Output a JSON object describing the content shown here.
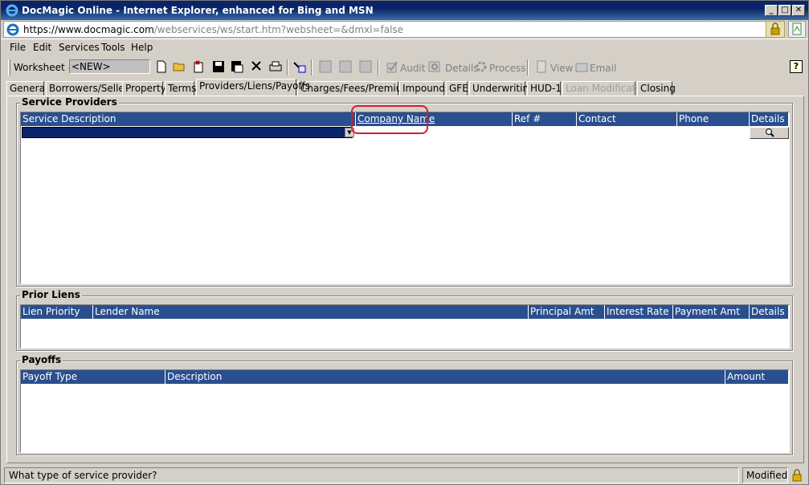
{
  "window": {
    "title": "DocMagic Online - Internet Explorer, enhanced for Bing and MSN",
    "minimize": "_",
    "maximize": "□",
    "close": "✕"
  },
  "address": {
    "url_host": "https://www.docmagic.com",
    "url_path": "/webservices/ws/start.htm?websheet=&dmxl=false"
  },
  "menu": [
    "File",
    "Edit",
    "Services",
    "Tools",
    "Help"
  ],
  "toolbar": {
    "worksheet_label": "Worksheet #",
    "worksheet_value": "<NEW>",
    "audit": "Audit",
    "details": "Details",
    "process": "Process",
    "view": "View",
    "email": "Email",
    "help": "?"
  },
  "tabs": [
    {
      "label": "General"
    },
    {
      "label": "Borrowers/Sellers"
    },
    {
      "label": "Property"
    },
    {
      "label": "Terms"
    },
    {
      "label": "Providers/Liens/Payoffs",
      "active": true
    },
    {
      "label": "Charges/Fees/Premiums"
    },
    {
      "label": "Impounds"
    },
    {
      "label": "GFE"
    },
    {
      "label": "Underwriting"
    },
    {
      "label": "HUD-1"
    },
    {
      "label": "Loan Modification",
      "disabled": true
    },
    {
      "label": "Closing"
    }
  ],
  "service_providers": {
    "title": "Service Providers",
    "columns": [
      "Service Description",
      "Company Name",
      "Ref #",
      "Contact",
      "Phone",
      "Details"
    ]
  },
  "prior_liens": {
    "title": "Prior Liens",
    "columns": [
      "Lien Priority",
      "Lender Name",
      "Principal Amt",
      "Interest Rate",
      "Payment Amt",
      "Details"
    ]
  },
  "payoffs": {
    "title": "Payoffs",
    "columns": [
      "Payoff Type",
      "Description",
      "Amount"
    ]
  },
  "status": {
    "message": "What type of service provider?",
    "state": "Modified"
  },
  "colors": {
    "title_bar": "#0a246a",
    "grid_header": "#2a4f8f",
    "highlight_circle": "#d32030"
  }
}
